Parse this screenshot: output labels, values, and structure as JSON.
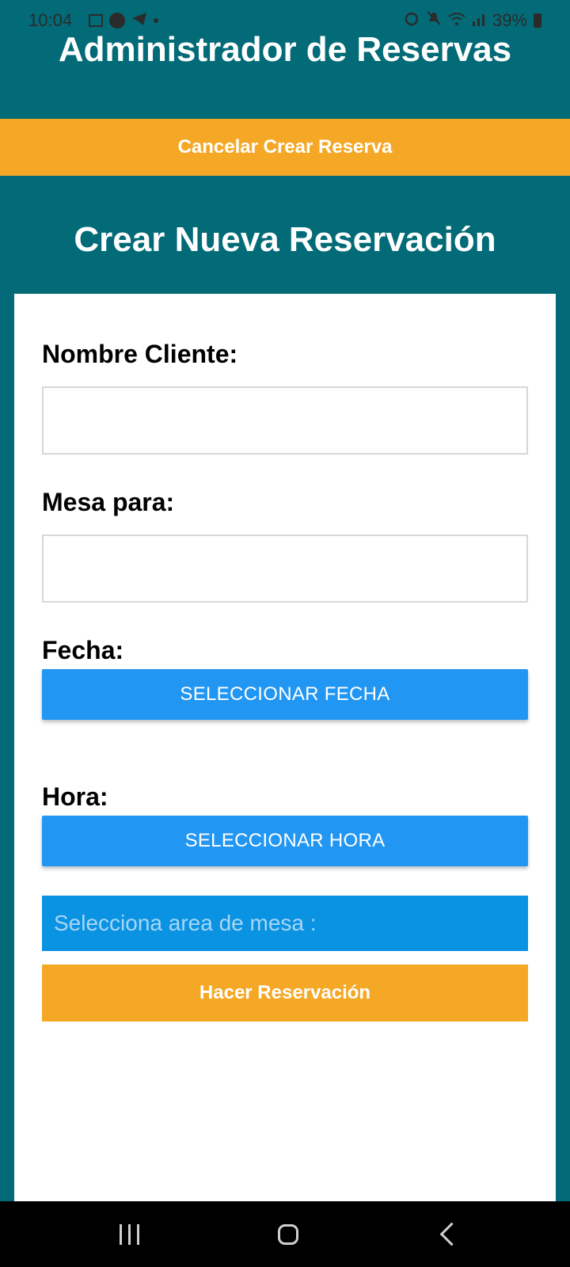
{
  "status_bar": {
    "time": "10:04",
    "battery": "39%",
    "left_icons": [
      "image-icon",
      "a-circle-icon",
      "telegram-icon",
      "dot-icon"
    ],
    "right_icons": [
      "alarm-icon",
      "mute-icon",
      "wifi-icon",
      "signal-icon",
      "battery-icon"
    ]
  },
  "header": {
    "title": "Administrador de Reservas",
    "cancel_label": "Cancelar Crear Reserva"
  },
  "form": {
    "title": "Crear Nueva Reservación",
    "nombre_label": "Nombre Cliente:",
    "nombre_value": "",
    "mesa_label": "Mesa para:",
    "mesa_value": "",
    "fecha_label": "Fecha:",
    "fecha_button": "SELECCIONAR FECHA",
    "hora_label": "Hora:",
    "hora_button": "SELECCIONAR HORA",
    "area_placeholder": "Selecciona area de mesa :",
    "submit_label": "Hacer Reservación"
  },
  "colors": {
    "background": "#026b77",
    "accent_orange": "#f5a826",
    "button_blue": "#2196f3",
    "select_blue": "#0a93e2"
  },
  "nav_bar": {
    "icons": [
      "recents-icon",
      "home-icon",
      "back-icon"
    ]
  }
}
